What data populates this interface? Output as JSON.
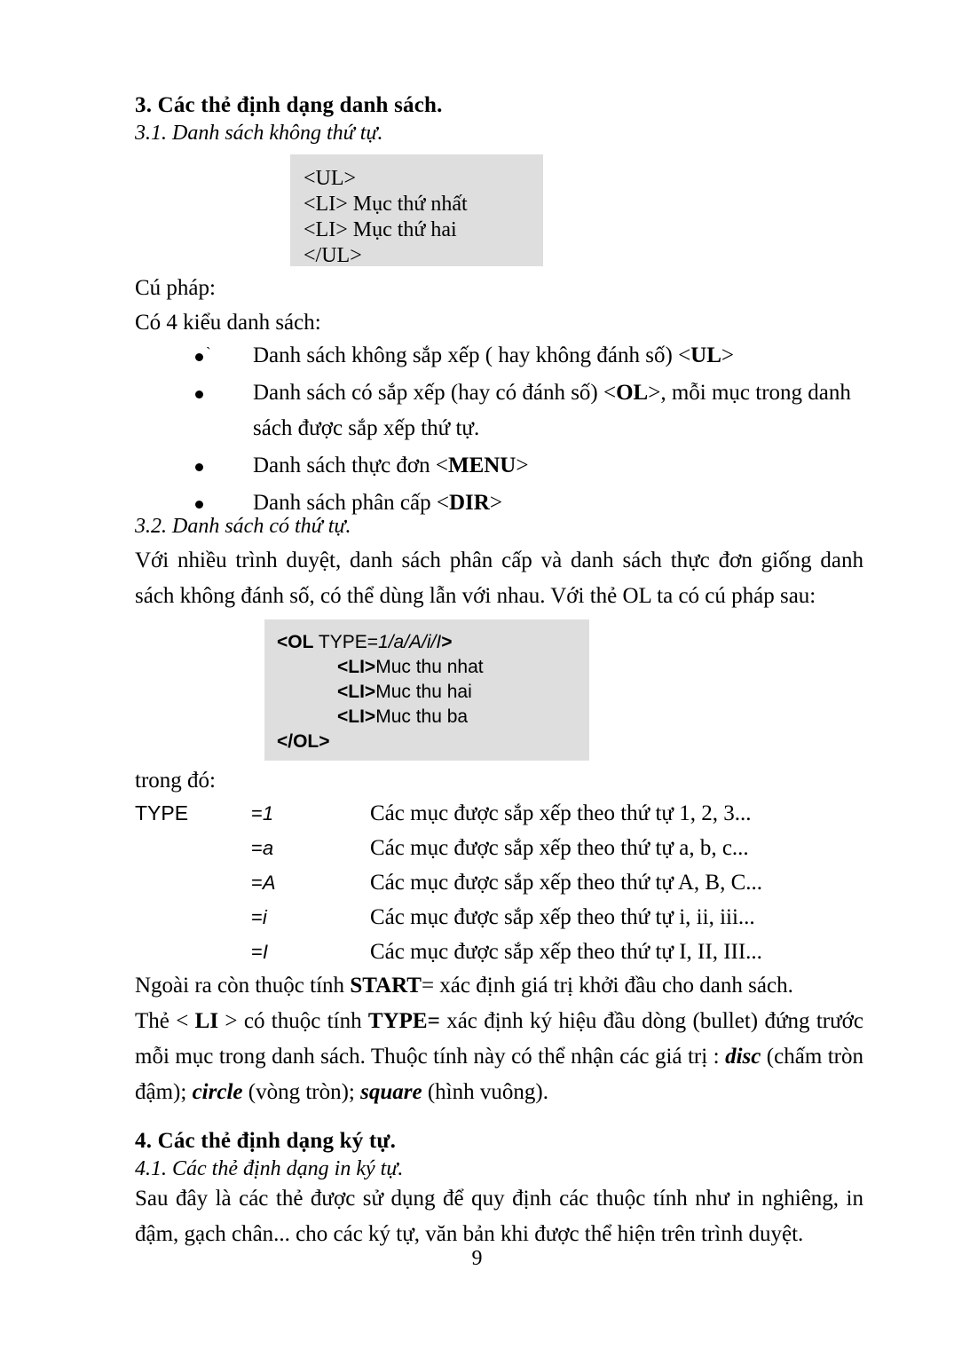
{
  "document": {
    "page_number": "9",
    "code_block_bg": "#dedede"
  },
  "section3": {
    "heading": "3. Các thẻ định dạng danh sách.",
    "sub_heading": "3.1. Danh sách không thứ tự.",
    "code_block": {
      "line1": "<UL>",
      "line2": "<LI> Mục thứ nhất",
      "line3": "<LI> Mục thứ hai",
      "line4": "</UL>"
    },
    "syntax_label": "Cú pháp:",
    "intro_label": "Có 4 kiểu danh sách:",
    "bullets": [
      {
        "text_before": "Danh sách không sắp xếp ( hay không đánh số) <",
        "tag": "UL",
        "text_after": ">",
        "stray_mark": "`"
      },
      {
        "text_before": "Danh sách có sắp xếp (hay có đánh số) <",
        "tag": "OL",
        "text_after": ">, mỗi mục trong danh sách được sắp xếp thứ tự.",
        "stray_mark": ""
      },
      {
        "text_before": "Danh sách thực đơn <",
        "tag": "MENU",
        "text_after": ">",
        "stray_mark": ""
      },
      {
        "text_before": "Danh sách phân cấp <",
        "tag": "DIR",
        "text_after": ">",
        "stray_mark": ""
      }
    ]
  },
  "section32": {
    "sub_heading": "3.2. Danh sách có thứ tự.",
    "paragraph": "Với nhiều trình duyệt, danh sách phân cấp và danh sách thực đơn giống danh sách không đánh số, có thể dùng lẫn với nhau. Với thẻ OL ta có cú pháp sau:",
    "code_block": {
      "line1_tag_open": "<OL",
      "line1_attr": " TYPE=",
      "line1_value": "1/a/A/i/I",
      "line1_close": ">",
      "line2_tag": "<LI>",
      "line2_text": "Muc thu nhat",
      "line3_tag": "<LI>",
      "line3_text": "Muc thu hai",
      "line4_tag": "<LI>",
      "line4_text": "Muc thu ba",
      "line5": "</OL>"
    },
    "where_label": "trong đó:",
    "type_table": {
      "key": "TYPE",
      "rows": [
        {
          "value_eq": "=",
          "value": "1",
          "desc": "Các mục được sắp xếp theo thứ tự 1, 2, 3..."
        },
        {
          "value_eq": "=",
          "value": "a",
          "desc": "Các mục được sắp xếp theo thứ tự a, b, c..."
        },
        {
          "value_eq": "=",
          "value": "A",
          "desc": "Các mục được sắp xếp theo thứ tự A, B, C..."
        },
        {
          "value_eq": "=",
          "value": "i",
          "desc": "Các mục được sắp xếp theo thứ tự i, ii, iii..."
        },
        {
          "value_eq": "=",
          "value": "I",
          "desc": "Các mục được sắp xếp theo thứ tự I, II, III..."
        }
      ]
    },
    "start_para": {
      "before": "Ngoài ra còn thuộc tính ",
      "bold": "START",
      "after": "= xác định giá trị khởi đầu cho danh sách."
    },
    "li_para": {
      "p1": "Thẻ < ",
      "b1": "LI",
      "p2": " > có thuộc tính ",
      "b2": "TYPE=",
      "p3": " xác định ký hiệu đầu dòng (bullet) đứng trước mỗi mục trong danh sách. Thuộc tính này có thể nhận các giá trị : ",
      "bi1": "disc",
      "p4": " (chấm tròn đậm); ",
      "bi2": "circle",
      "p5": " (vòng tròn); ",
      "bi3": "square",
      "p6": " (hình vuông)."
    }
  },
  "section4": {
    "heading": "4. Các thẻ định dạng ký tự.",
    "sub_heading": "4.1. Các thẻ định dạng in ký tự.",
    "paragraph": "Sau đây là các thẻ được sử dụng để quy định các thuộc tính như in nghiêng, in đậm, gạch chân... cho các ký tự, văn bản khi được thể hiện trên trình duyệt."
  }
}
